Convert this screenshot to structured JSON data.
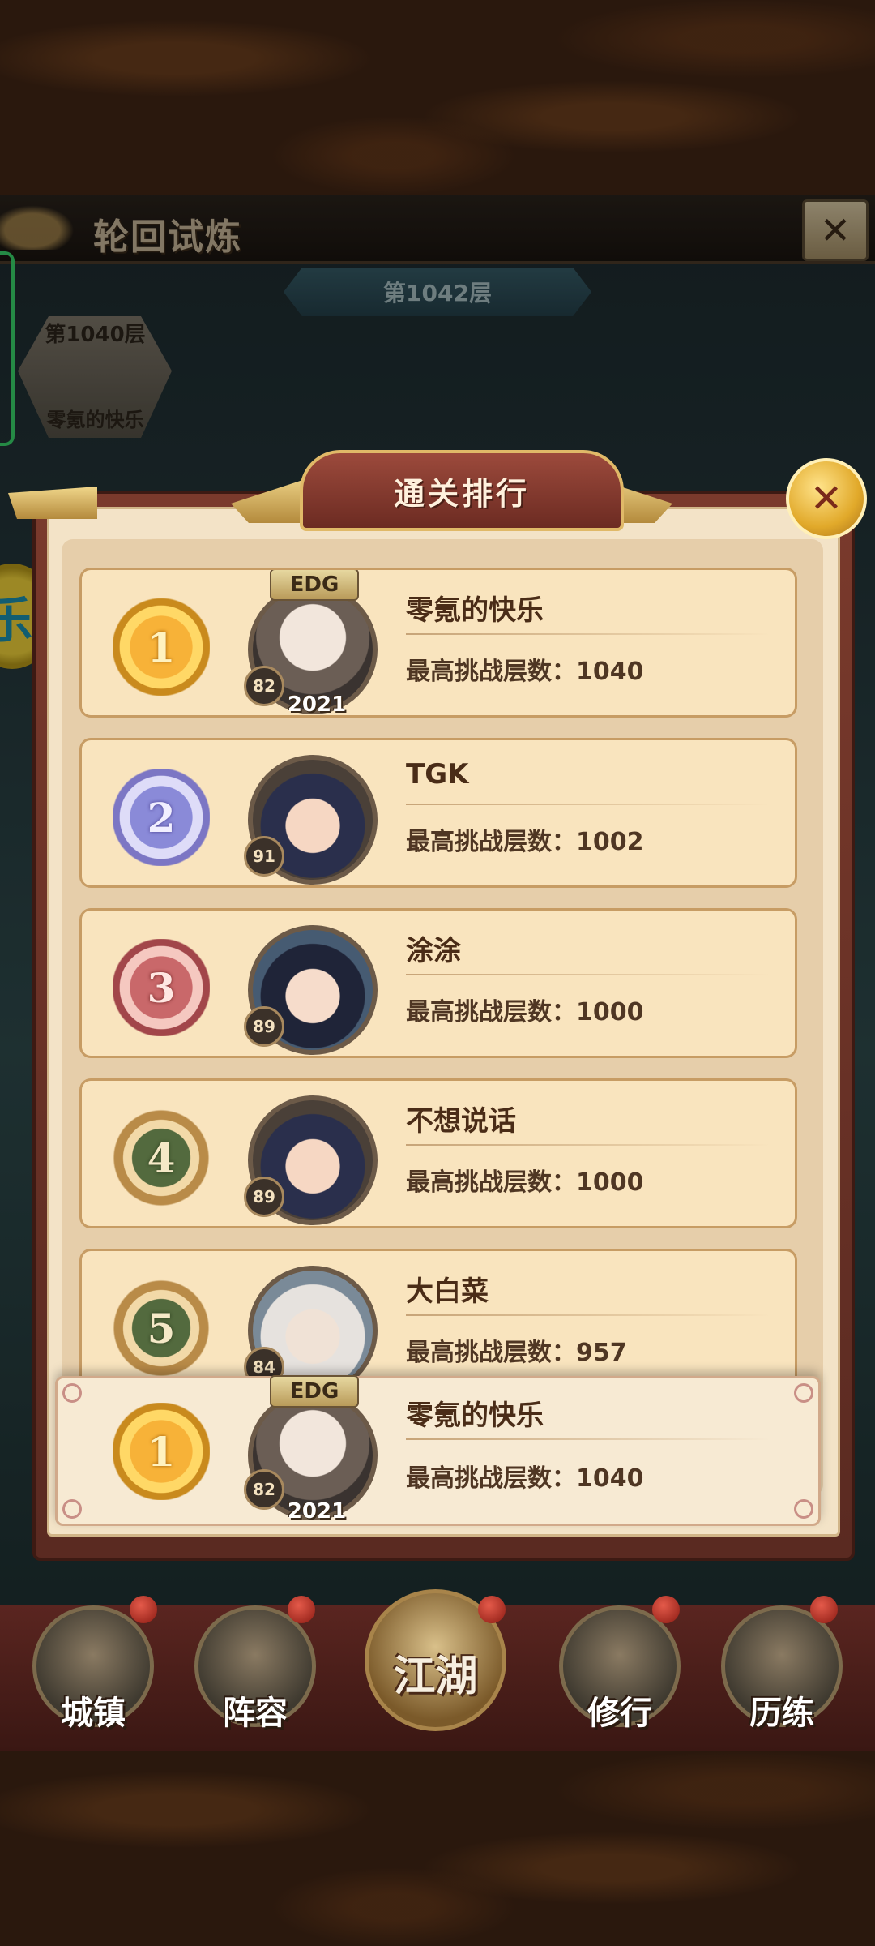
{
  "header": {
    "title": "轮回试炼",
    "close_icon": "close-x-icon",
    "current_floor": "第1042层"
  },
  "record_badge": {
    "floor": "第1040层",
    "name": "零氪的快乐"
  },
  "side_badge": {
    "glyph": "乐"
  },
  "ranking_panel": {
    "title": "通关排行",
    "close_icon": "close-x-icon",
    "rows": [
      {
        "rank": "1",
        "level": "82",
        "name": "零氪的快乐",
        "score": "最高挑战层数：1040",
        "tag": "EDG",
        "year": "2021"
      },
      {
        "rank": "2",
        "level": "91",
        "name": "TGK",
        "score": "最高挑战层数：1002"
      },
      {
        "rank": "3",
        "level": "89",
        "name": "涂涂",
        "score": "最高挑战层数：1000"
      },
      {
        "rank": "4",
        "level": "89",
        "name": "不想说话",
        "score": "最高挑战层数：1000"
      },
      {
        "rank": "5",
        "level": "84",
        "name": "大白菜",
        "score": "最高挑战层数：957"
      }
    ],
    "self_row": {
      "rank": "1",
      "level": "82",
      "name": "零氪的快乐",
      "score": "最高挑战层数：1040",
      "tag": "EDG",
      "year": "2021"
    }
  },
  "bottom_nav": {
    "items": [
      {
        "label": "城镇"
      },
      {
        "label": "阵容"
      },
      {
        "label": "江湖"
      },
      {
        "label": "修行"
      },
      {
        "label": "历练"
      }
    ]
  }
}
